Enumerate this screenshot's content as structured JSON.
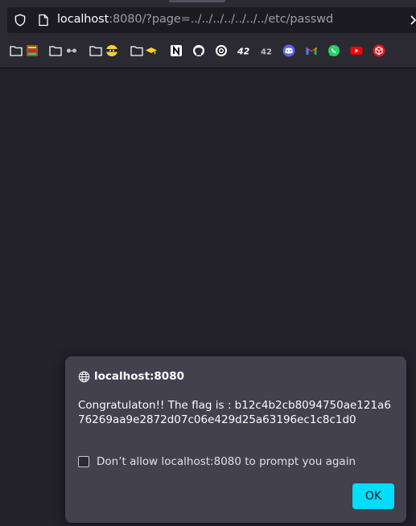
{
  "browser": {
    "url_host": "localhost",
    "url_rest": ":8080/?page=../../../../../../../etc/passwd"
  },
  "bookmarks": [
    {
      "type": "folder",
      "icon": "abacus-icon",
      "color": "#e5a50a"
    },
    {
      "type": "folder",
      "icon": "glasses-icon",
      "color": "#c0c0c8"
    },
    {
      "type": "folder",
      "icon": "ninja-icon",
      "color": "#f6d32d"
    },
    {
      "type": "folder",
      "icon": "graduation-cap-icon",
      "color": "#f6d32d"
    },
    {
      "type": "site",
      "icon": "notion-icon"
    },
    {
      "type": "site",
      "icon": "github-icon"
    },
    {
      "type": "site",
      "icon": "openai-icon"
    },
    {
      "type": "site",
      "icon": "42-icon"
    },
    {
      "type": "site",
      "icon": "42-intra-icon"
    },
    {
      "type": "site",
      "icon": "discord-icon",
      "color": "#5865f2"
    },
    {
      "type": "site",
      "icon": "gmail-icon"
    },
    {
      "type": "site",
      "icon": "whatsapp-icon",
      "color": "#25d366"
    },
    {
      "type": "site",
      "icon": "youtube-icon",
      "color": "#ff0000"
    },
    {
      "type": "site",
      "icon": "red-cube-icon",
      "color": "#e01b24"
    }
  ],
  "dialog": {
    "origin": "localhost:8080",
    "message": "Congratulaton!! The flag is : b12c4b2cb8094750ae121a676269aa9e2872d07c06e429d25a63196ec1c8c1d0",
    "checkbox_label": "Don’t allow localhost:8080 to prompt you again",
    "checkbox_checked": false,
    "ok_label": "OK",
    "accent": "#00ddff"
  }
}
